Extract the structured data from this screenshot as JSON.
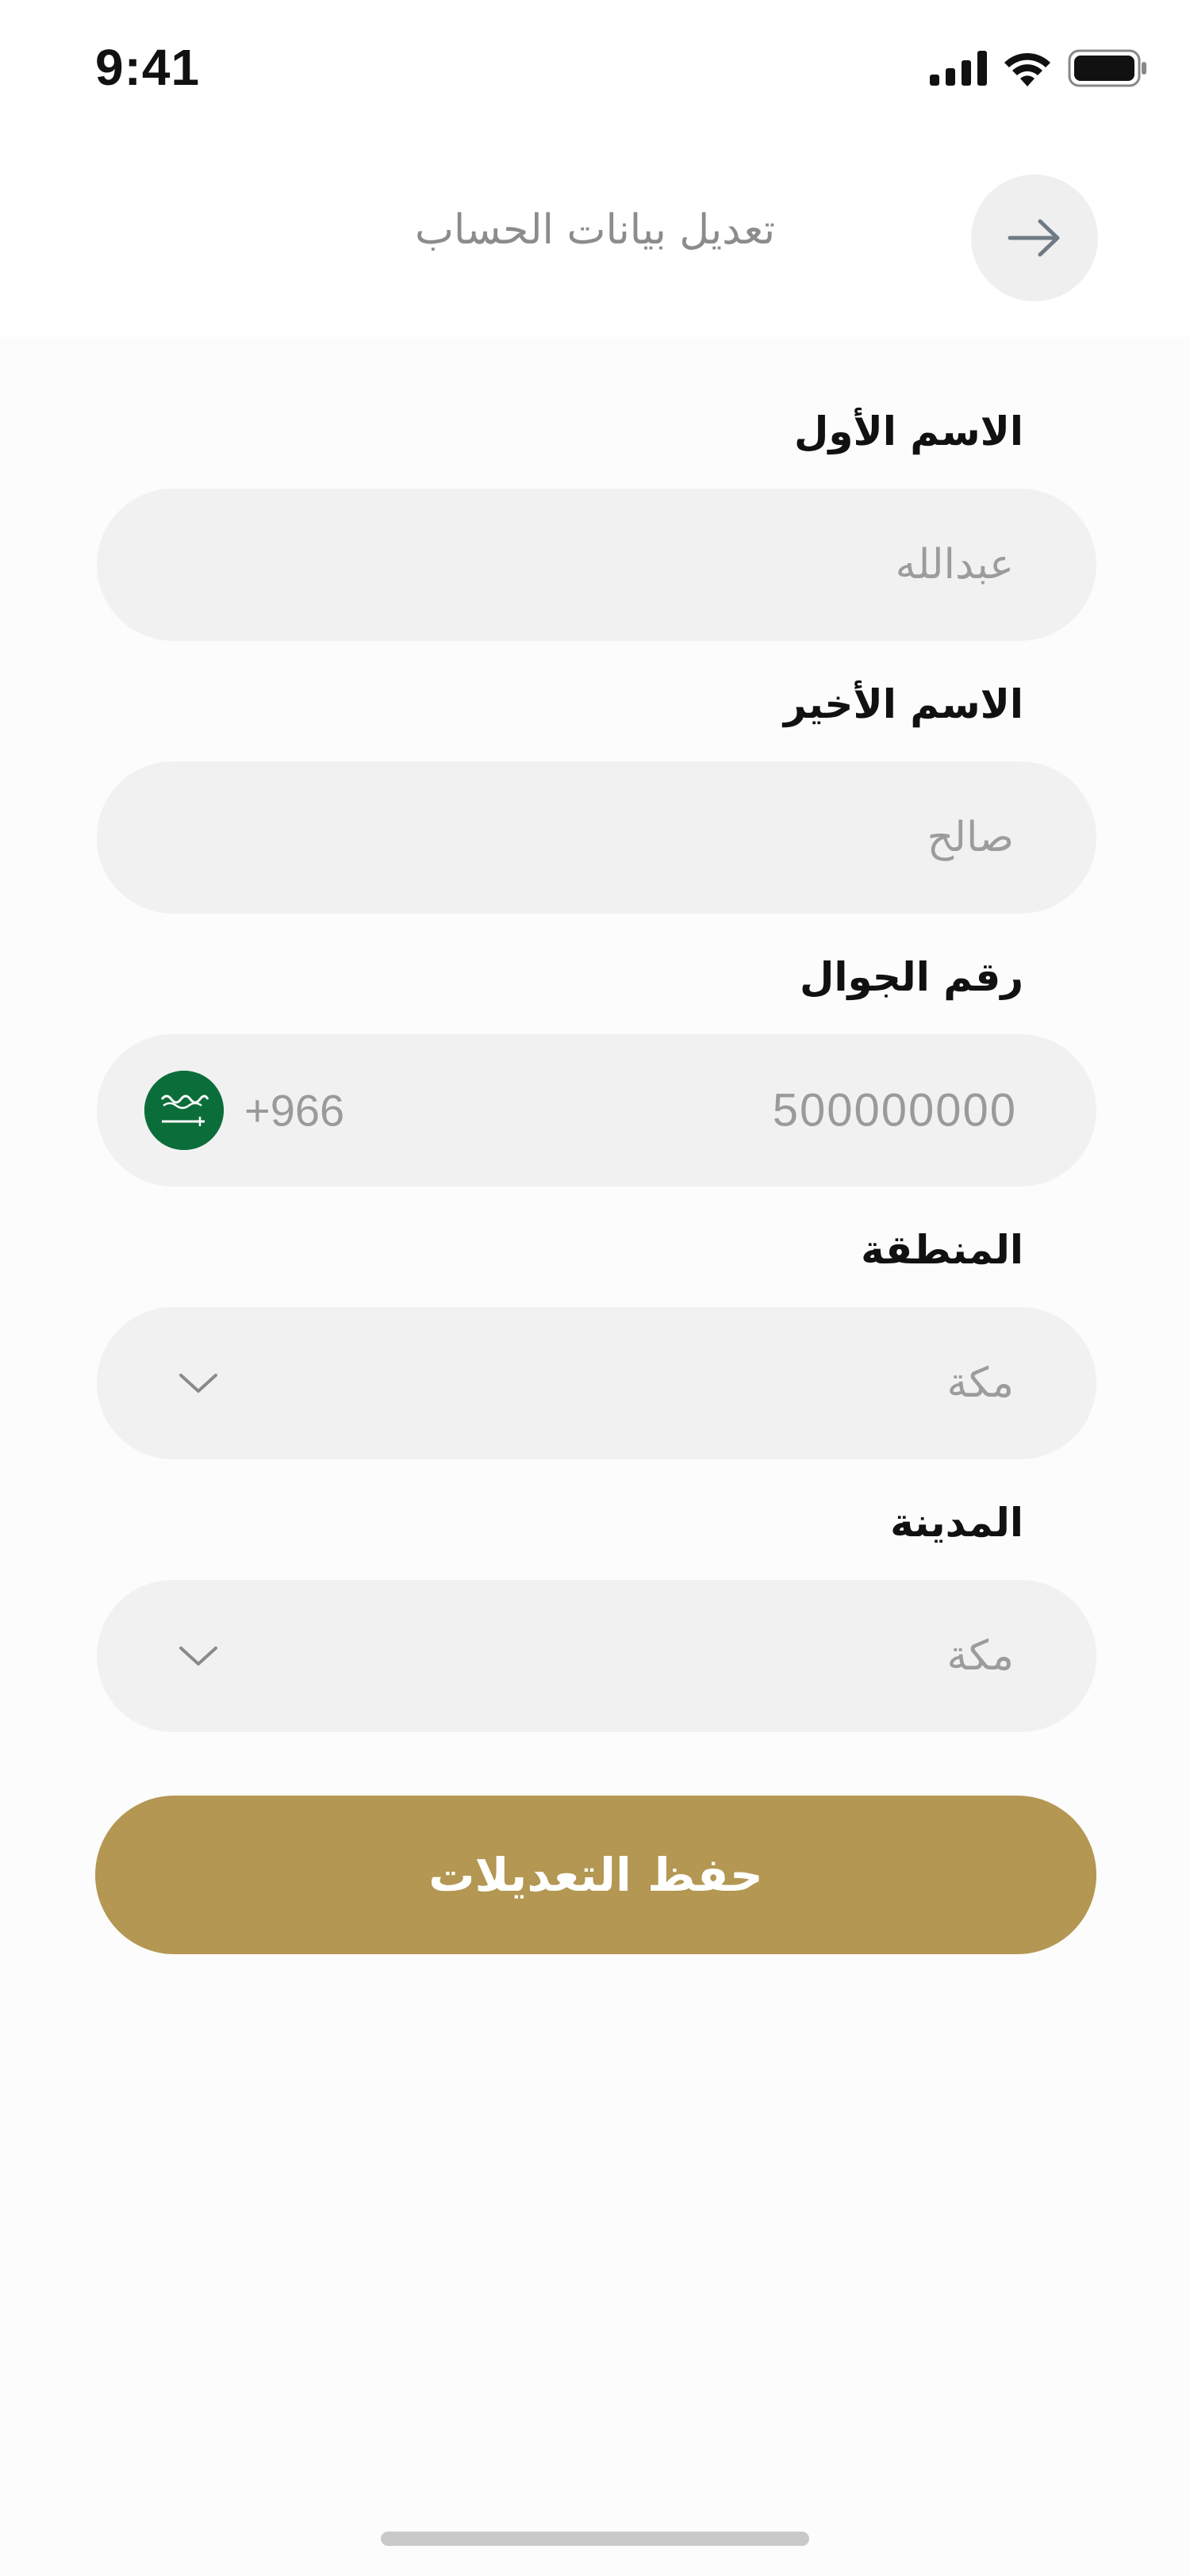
{
  "status_bar": {
    "time": "9:41",
    "icons": [
      "signal-icon",
      "wifi-icon",
      "battery-icon"
    ]
  },
  "header": {
    "title": "تعديل بيانات الحساب",
    "back_icon": "arrow-right-icon"
  },
  "form": {
    "first_name": {
      "label": "الاسم الأول",
      "value": "عبدالله"
    },
    "last_name": {
      "label": "الاسم الأخير",
      "value": "صالح"
    },
    "phone": {
      "label": "رقم الجوال",
      "dial_code": "+966",
      "value": "500000000",
      "flag_icon": "saudi-flag-icon"
    },
    "region": {
      "label": "المنطقة",
      "value": "مكة",
      "icon": "chevron-down-icon"
    },
    "city": {
      "label": "المدينة",
      "value": "مكة",
      "icon": "chevron-down-icon"
    }
  },
  "save_button": {
    "label": "حفظ التعديلات"
  },
  "colors": {
    "accent": "#b39752",
    "field_bg": "#f1f1f1",
    "placeholder_text": "#9c9c9c",
    "flag_green": "#0b6e3a"
  }
}
